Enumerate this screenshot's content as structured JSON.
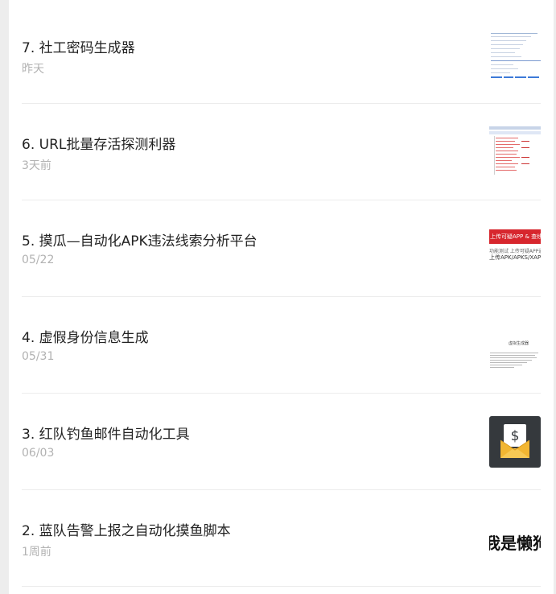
{
  "articles": [
    {
      "title": "7. 社工密码生成器",
      "date": "昨天"
    },
    {
      "title": "6. URL批量存活探测利器",
      "date": "3天前"
    },
    {
      "title": "5. 摸瓜—自动化APK违法线索分析平台",
      "date": "05/22"
    },
    {
      "title": "4. 虚假身份信息生成",
      "date": "05/31"
    },
    {
      "title": "3. 红队钓鱼邮件自动化工具",
      "date": "06/03"
    },
    {
      "title": "2. 蓝队告警上报之自动化摸鱼脚本",
      "date": "1周前"
    }
  ],
  "thumb_text": {
    "t3_banner": "上传可疑APP & 查线",
    "t3_line1": "功能测试 上传可疑APP通过检测",
    "t3_line2": "上传APK/APKS/XAPK",
    "t4_heading": "虚拟生成器",
    "t6_text": "我是懒狗"
  },
  "colors": {
    "accent_blue": "#3d7ad8",
    "banner_red": "#d7262d",
    "mail_yellow": "#f2b632"
  }
}
